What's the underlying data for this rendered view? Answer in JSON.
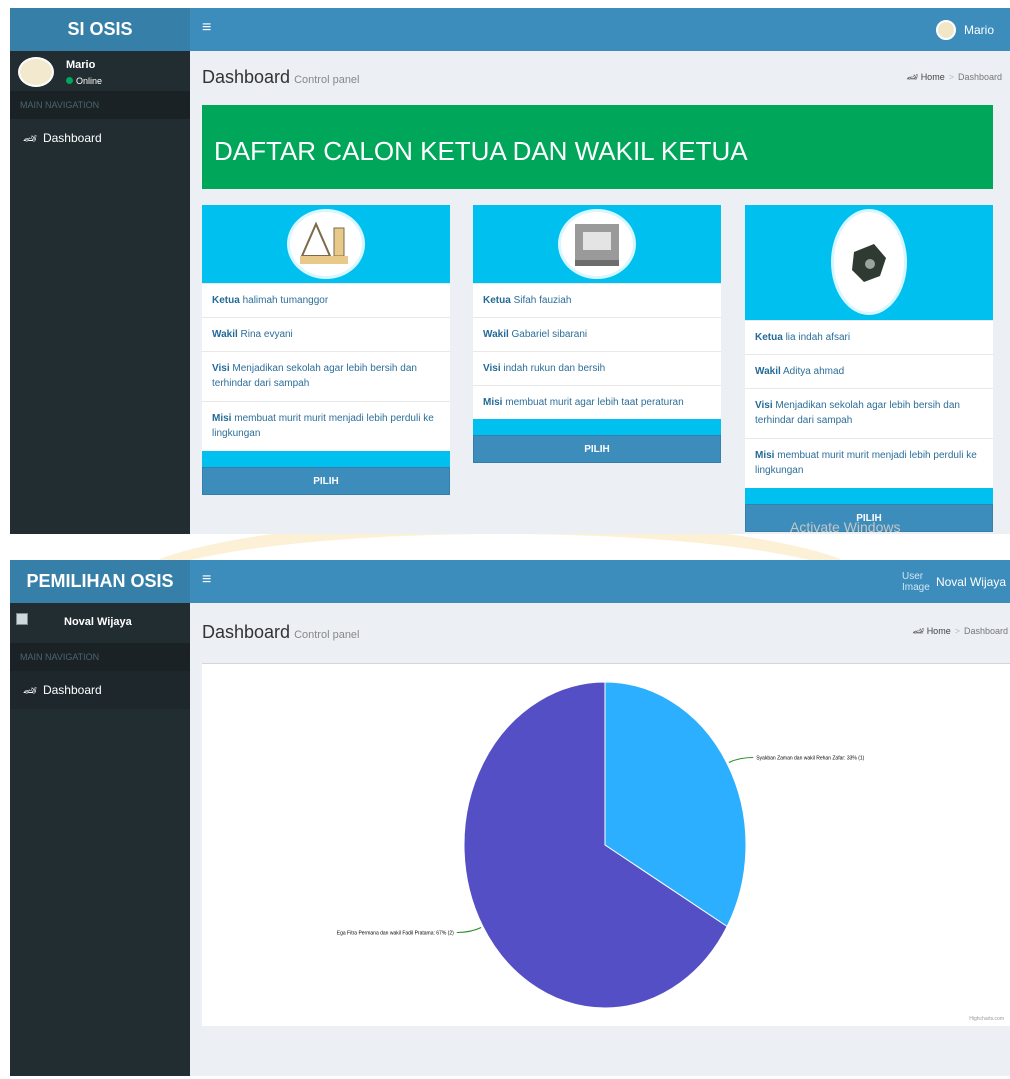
{
  "panel1": {
    "brand": "SI OSIS",
    "topbar": {
      "menu_icon": "hamburger-icon",
      "menu_glyph": "≡",
      "user": "Mario"
    },
    "sidebar": {
      "user_name": "Mario",
      "user_status": "Online",
      "nav_header": "MAIN NAVIGATION",
      "items": [
        {
          "label": "Dashboard",
          "icon": "dashboard-icon"
        }
      ]
    },
    "header": {
      "title": "Dashboard",
      "subtitle": "Control panel"
    },
    "breadcrumb": {
      "home": "Home",
      "sep": ">",
      "current": "Dashboard"
    },
    "banner": "DAFTAR CALON KETUA DAN WAKIL KETUA",
    "candidates": [
      {
        "ketua_label": "Ketua",
        "ketua": "halimah tumanggor",
        "wakil_label": "Wakil",
        "wakil": "Rina evyani",
        "visi_label": "Visi",
        "visi": "Menjadikan sekolah agar lebih bersih dan terhindar dari sampah",
        "misi_label": "Misi",
        "misi": "membuat murit murit menjadi lebih perduli ke lingkungan",
        "button": "PILIH"
      },
      {
        "ketua_label": "Ketua",
        "ketua": "Sifah fauziah",
        "wakil_label": "Wakil",
        "wakil": "Gabariel sibarani",
        "visi_label": "Visi",
        "visi": "indah rukun dan bersih",
        "misi_label": "Misi",
        "misi": "membuat murit agar lebih taat peraturan",
        "button": "PILIH"
      },
      {
        "ketua_label": "Ketua",
        "ketua": "lia indah afsari",
        "wakil_label": "Wakil",
        "wakil": "Aditya ahmad",
        "visi_label": "Visi",
        "visi": "Menjadikan sekolah agar lebih bersih dan terhindar dari sampah",
        "misi_label": "Misi",
        "misi": "membuat murit murit menjadi lebih perduli ke lingkungan",
        "button": "PILIH"
      }
    ],
    "watermark": "Activate Windows"
  },
  "panel2": {
    "brand": "PEMILIHAN OSIS",
    "topbar": {
      "menu_icon": "hamburger-icon",
      "menu_glyph": "≡",
      "user": "Noval Wijaya",
      "broken_image_text": "User Image"
    },
    "sidebar": {
      "user_name": "Noval Wijaya",
      "nav_header": "MAIN NAVIGATION",
      "items": [
        {
          "label": "Dashboard",
          "icon": "dashboard-icon"
        }
      ]
    },
    "header": {
      "title": "Dashboard",
      "subtitle": "Control panel"
    },
    "breadcrumb": {
      "home": "Home",
      "sep": ">",
      "current": "Dashboard"
    },
    "credits": "Highcharts.com"
  },
  "chart_data": {
    "type": "pie",
    "series": [
      {
        "label": "Syakban Zaman dan wakil Rehan Zafar: 33% (1)",
        "value": 1,
        "percent": 33,
        "color": "#2caffe"
      },
      {
        "label": "Ega Fitra Permana dan wakil Fadil Pratama: 67% (2)",
        "value": 2,
        "percent": 67,
        "color": "#544fc5"
      }
    ]
  },
  "colors": {
    "header_blue": "#3c8dbc",
    "logo_blue": "#367fa9",
    "sidebar_dark": "#222d32",
    "banner_green": "#00a65a",
    "card_cyan": "#00c0ef"
  }
}
